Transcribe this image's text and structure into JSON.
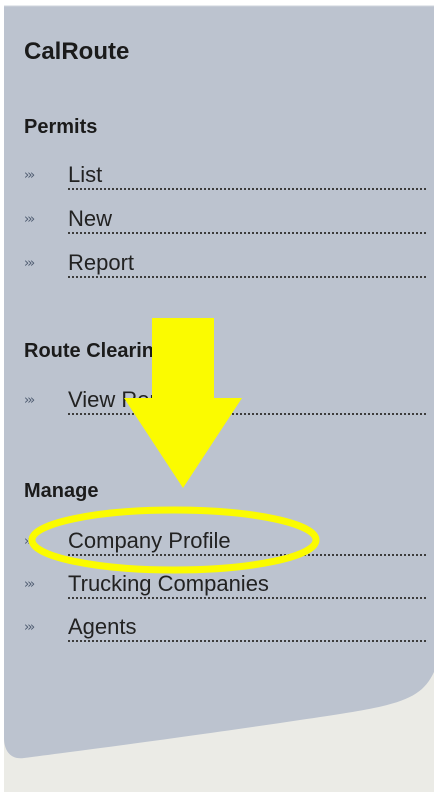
{
  "sidebar": {
    "brand": "CalRoute",
    "sections": [
      {
        "heading": "Permits",
        "items": [
          {
            "label": "List"
          },
          {
            "label": "New"
          },
          {
            "label": "Report"
          }
        ]
      },
      {
        "heading": "Route Clearing",
        "items": [
          {
            "label": "View Routes"
          }
        ]
      },
      {
        "heading": "Manage",
        "items": [
          {
            "label": "Company Profile"
          },
          {
            "label": "Trucking Companies"
          },
          {
            "label": "Agents"
          }
        ]
      }
    ]
  },
  "nav_arrow_glyph": "›»",
  "colors": {
    "panel": "#bcc3cf",
    "page_background": "#ebebe6",
    "highlight": "#fbfb00"
  },
  "annotation": {
    "shape": "down-arrow",
    "highlight_shape": "ellipse",
    "highlighted_item": "Company Profile"
  }
}
